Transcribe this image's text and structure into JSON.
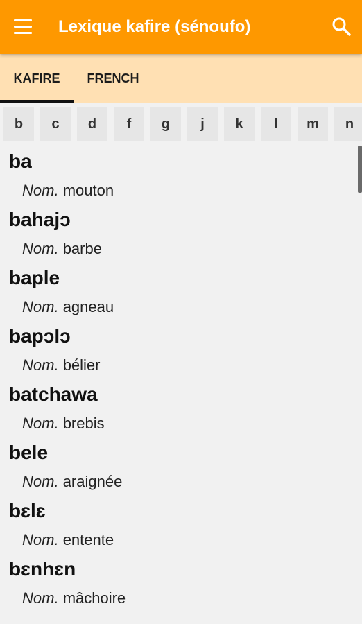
{
  "app_bar": {
    "title": "Lexique kafire (sénoufo)",
    "menu_icon": "menu-icon",
    "search_icon": "search-icon",
    "color": "#fe9800"
  },
  "tabs": [
    {
      "label": "KAFIRE",
      "selected": true
    },
    {
      "label": "FRENCH",
      "selected": false
    }
  ],
  "letters": [
    "b",
    "c",
    "d",
    "f",
    "g",
    "j",
    "k",
    "l",
    "m",
    "n"
  ],
  "entries": [
    {
      "word": "ba",
      "pos": "Nom.",
      "definition": "mouton"
    },
    {
      "word": "bahajɔ",
      "pos": "Nom.",
      "definition": "barbe"
    },
    {
      "word": "baple",
      "pos": "Nom.",
      "definition": "agneau"
    },
    {
      "word": "bapɔlɔ",
      "pos": "Nom.",
      "definition": "bélier"
    },
    {
      "word": "batchawa",
      "pos": "Nom.",
      "definition": "brebis"
    },
    {
      "word": "bele",
      "pos": "Nom.",
      "definition": "araignée"
    },
    {
      "word": "bɛlɛ",
      "pos": "Nom.",
      "definition": "entente"
    },
    {
      "word": "bɛnhɛn",
      "pos": "Nom.",
      "definition": "mâchoire"
    }
  ]
}
